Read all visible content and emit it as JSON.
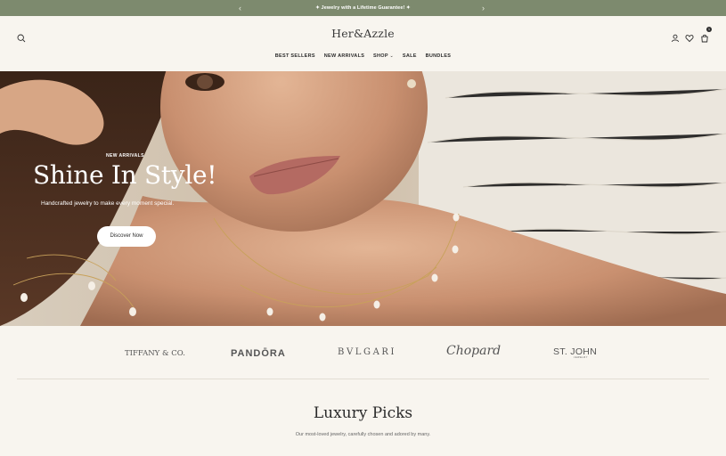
{
  "announcement": {
    "prev": "‹",
    "next": "›",
    "message": "✦ Jewelry with a Lifetime Guarantee! ✦"
  },
  "header": {
    "logo": "Her&Azzle",
    "nav": [
      {
        "label": "BEST SELLERS"
      },
      {
        "label": "NEW ARRIVALS"
      },
      {
        "label": "SHOP"
      },
      {
        "label": "SALE"
      },
      {
        "label": "BUNDLES"
      }
    ],
    "shop_chevron": "⌄",
    "cart_count": "1",
    "icons": [
      "search-icon",
      "account-icon",
      "wishlist-icon",
      "cart-icon"
    ]
  },
  "hero": {
    "eyebrow": "NEW ARRIVALS",
    "title": "Shine In Style!",
    "subtitle": "Handcrafted jewelry to make every moment special.",
    "cta": "Discover Now"
  },
  "brands": {
    "b1": "TIFFANY & CO.",
    "b2": "PANDŌRA",
    "b3": "BVLGARI",
    "b4": "Chopard",
    "b5": "ST. JOHN",
    "b5_sub": "JEWELRY"
  },
  "section": {
    "title": "Luxury Picks",
    "subtitle": "Our most-loved jewelry, carefully chosen and adored by many."
  },
  "colors": {
    "announce_bg": "#7d8a6e",
    "page_bg": "#f8f5ef",
    "text": "#2b2b2b"
  }
}
